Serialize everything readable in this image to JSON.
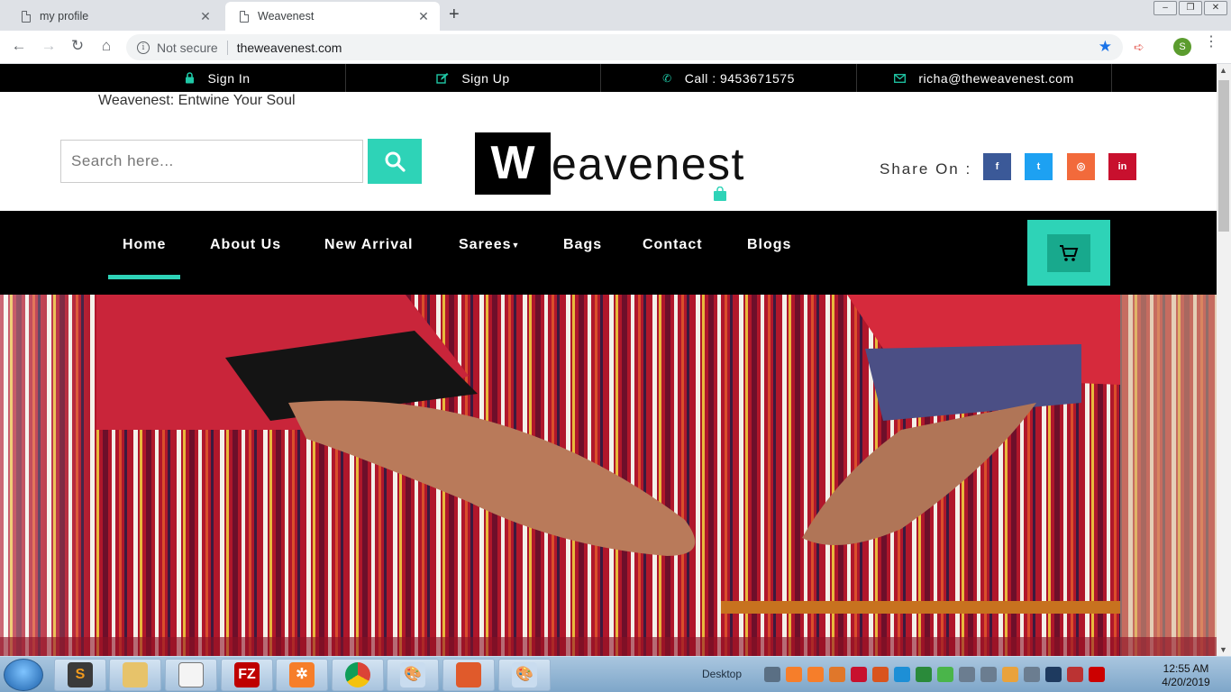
{
  "browser": {
    "tabs": [
      {
        "title": "my profile",
        "active": false
      },
      {
        "title": "Weavenest",
        "active": true
      }
    ],
    "security_label": "Not secure",
    "url": "theweavenest.com",
    "profile_initial": "S"
  },
  "topbar": {
    "sign_in": "Sign In",
    "sign_up": "Sign Up",
    "call": "Call : 9453671575",
    "email": "richa@theweavenest.com"
  },
  "header": {
    "tagline": "Weavenest: Entwine Your Soul",
    "search_placeholder": "Search here...",
    "logo_letter": "W",
    "logo_rest": "eavenest",
    "share_label": "Share On :",
    "social": [
      {
        "name": "facebook",
        "glyph": "f",
        "color": "#3b5998"
      },
      {
        "name": "twitter",
        "glyph": "t",
        "color": "#1da1f2"
      },
      {
        "name": "instagram",
        "glyph": "◎",
        "color": "#f26a3b"
      },
      {
        "name": "linkedin",
        "glyph": "in",
        "color": "#c8102e"
      }
    ]
  },
  "nav": {
    "items": [
      "Home",
      "About Us",
      "New Arrival",
      "Sarees",
      "Bags",
      "Contact",
      "Blogs"
    ],
    "active": "Home",
    "accent": "#2ed3b7"
  },
  "taskbar": {
    "desktop_label": "Desktop",
    "time": "12:55 AM",
    "date": "4/20/2019"
  }
}
